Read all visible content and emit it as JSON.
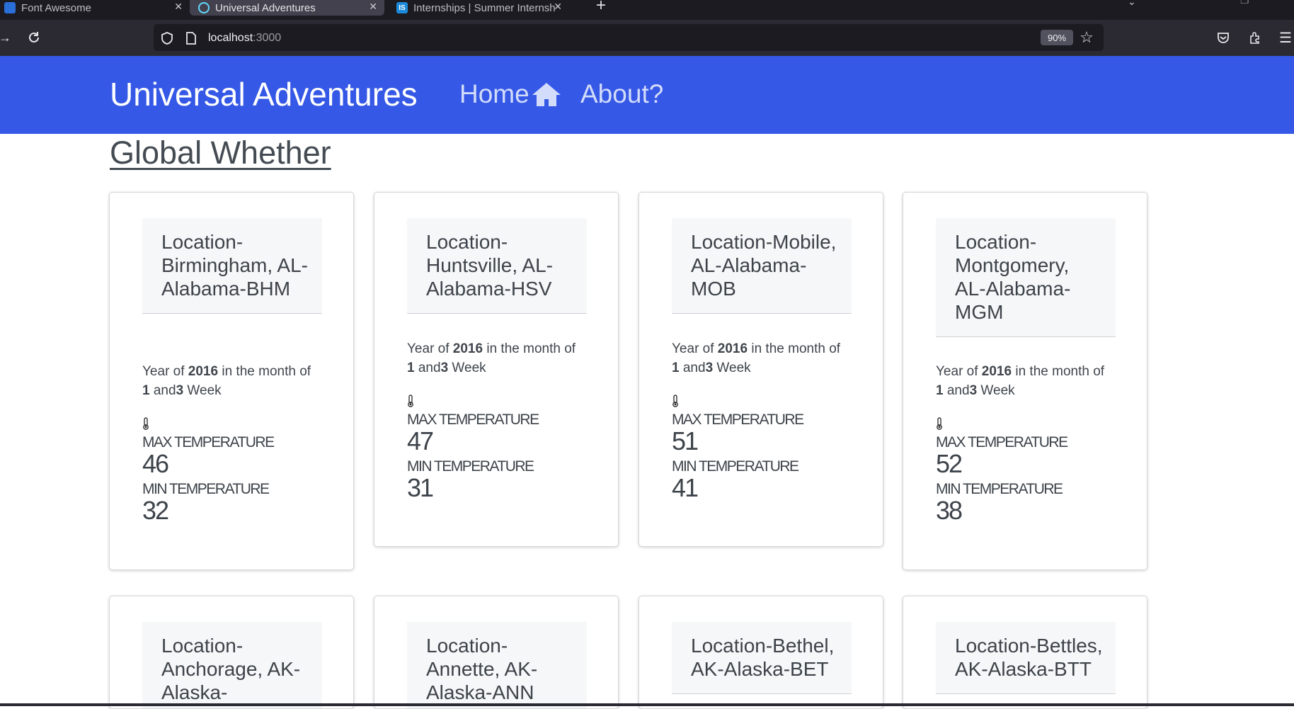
{
  "browser": {
    "tabs": [
      {
        "label": "Font Awesome",
        "active": false
      },
      {
        "label": "Universal Adventures",
        "active": true
      },
      {
        "label": "Internships | Summer Internship",
        "active": false
      }
    ],
    "url_host": "localhost",
    "url_port": ":3000",
    "zoom": "90%",
    "colors": {
      "chrome_bg": "#1c1b22",
      "toolbar_bg": "#2b2a33",
      "active_tab_bg": "#42414d"
    }
  },
  "header": {
    "brand": "Universal Adventures",
    "nav": {
      "home": "Home",
      "about": "About?"
    },
    "bg_color": "#3558e6"
  },
  "page": {
    "title": "Global Whether"
  },
  "weather_cards": [
    {
      "location_text": "Location-Birmingham, AL-Alabama-BHM",
      "year_prefix": "Year of ",
      "year": "2016",
      "month_prefix": " in the month of",
      "month": "1",
      "week_prefix": " and",
      "week": "3",
      "week_suffix": " Week",
      "max_label": "MAX TEMPERATURE",
      "max_temp": "46",
      "min_label": "MIN TEMPERATURE",
      "min_temp": "32"
    },
    {
      "location_text": "Location-Huntsville, AL-Alabama-HSV",
      "year_prefix": "Year of ",
      "year": "2016",
      "month_prefix": " in the month of",
      "month": "1",
      "week_prefix": " and",
      "week": "3",
      "week_suffix": " Week",
      "max_label": "MAX TEMPERATURE",
      "max_temp": "47",
      "min_label": "MIN TEMPERATURE",
      "min_temp": "31"
    },
    {
      "location_text": "Location-Mobile, AL-Alabama-MOB",
      "year_prefix": "Year of ",
      "year": "2016",
      "month_prefix": " in the month of",
      "month": "1",
      "week_prefix": " and",
      "week": "3",
      "week_suffix": " Week",
      "max_label": "MAX TEMPERATURE",
      "max_temp": "51",
      "min_label": "MIN TEMPERATURE",
      "min_temp": "41"
    },
    {
      "location_text": "Location-Montgomery, AL-Alabama-MGM",
      "year_prefix": "Year of ",
      "year": "2016",
      "month_prefix": " in the month of",
      "month": "1",
      "week_prefix": " and",
      "week": "3",
      "week_suffix": " Week",
      "max_label": "MAX TEMPERATURE",
      "max_temp": "52",
      "min_label": "MIN TEMPERATURE",
      "min_temp": "38"
    },
    {
      "location_text": "Location-Anchorage, AK-Alaska-"
    },
    {
      "location_text": "Location-Annette, AK-Alaska-ANN"
    },
    {
      "location_text": "Location-Bethel, AK-Alaska-BET"
    },
    {
      "location_text": "Location-Bettles, AK-Alaska-BTT"
    }
  ]
}
